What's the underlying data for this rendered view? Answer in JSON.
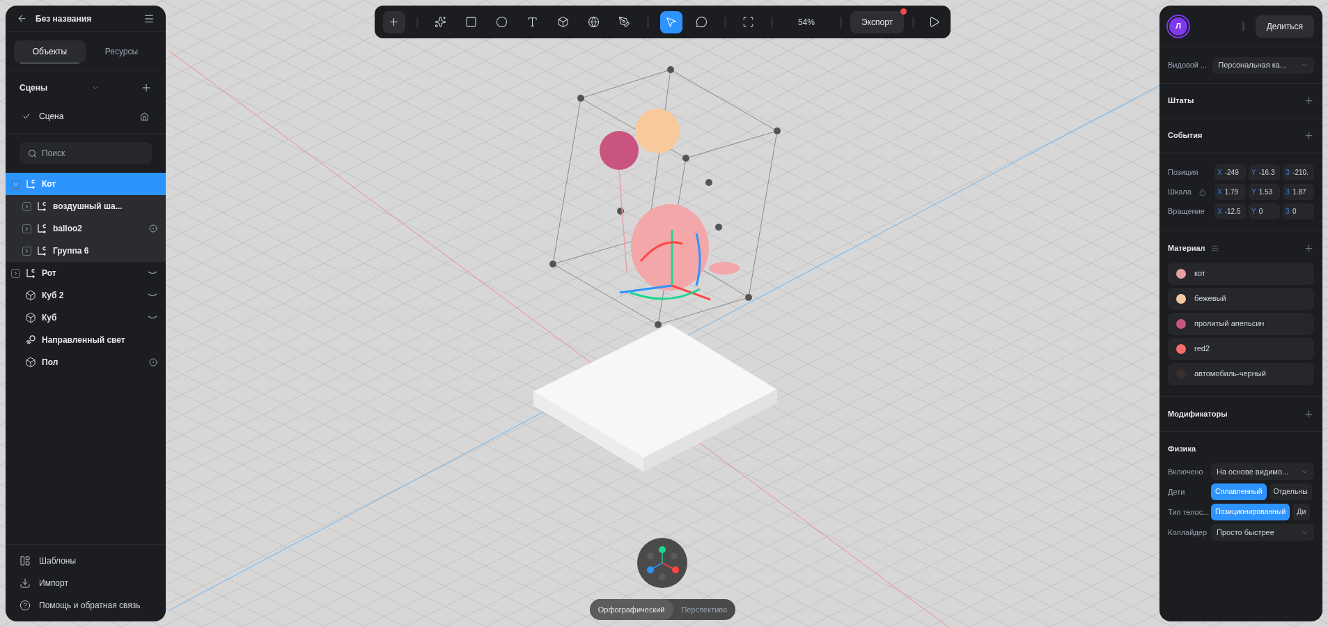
{
  "left_panel": {
    "title": "Без названия",
    "tabs": [
      {
        "label": "Объекты",
        "selected": true
      },
      {
        "label": "Ресурсы",
        "selected": false
      }
    ],
    "scenes_header": "Сцены",
    "scenes": [
      {
        "label": "Сцена",
        "selected": true
      }
    ],
    "search": {
      "placeholder": "Поиск"
    },
    "tree": [
      {
        "label": "Кот",
        "kind": "group",
        "selected": true,
        "expanded": true,
        "children": [
          {
            "label": "воздушный ша...",
            "kind": "group",
            "selected": false,
            "expanded": false
          },
          {
            "label": "balloo2",
            "kind": "group",
            "selected": false,
            "expanded": false,
            "indicator": {
              "kind": "target"
            }
          },
          {
            "label": "Группа 6",
            "kind": "group",
            "selected": false,
            "expanded": false
          }
        ]
      },
      {
        "label": "Рот",
        "kind": "group",
        "selected": false,
        "expanded": false,
        "indicator": {
          "kind": "curve"
        }
      },
      {
        "label": "Куб 2",
        "kind": "cube",
        "selected": false,
        "indicator": {
          "kind": "curve"
        }
      },
      {
        "label": "Куб",
        "kind": "cube",
        "selected": false,
        "indicator": {
          "kind": "curve"
        }
      },
      {
        "label": "Направленный свет",
        "kind": "light",
        "selected": false
      },
      {
        "label": "Пол",
        "kind": "cube",
        "selected": false,
        "indicator": {
          "kind": "target"
        }
      }
    ],
    "footer": [
      {
        "label": "Шаблоны",
        "kind": "templates"
      },
      {
        "label": "Импорт",
        "kind": "import"
      },
      {
        "label": "Помощь и обратная связь",
        "kind": "help"
      }
    ]
  },
  "toolbar": {
    "tools": [
      {
        "kind": "add",
        "selected": false
      },
      {
        "kind": "ai",
        "selected": false
      },
      {
        "kind": "rectangle",
        "selected": false
      },
      {
        "kind": "ellipse",
        "selected": false
      },
      {
        "kind": "text",
        "selected": false
      },
      {
        "kind": "cube",
        "selected": false
      },
      {
        "kind": "sphere",
        "selected": false
      },
      {
        "kind": "pen",
        "selected": false
      },
      {
        "kind": "pointer",
        "selected": true
      },
      {
        "kind": "comment",
        "selected": false
      },
      {
        "kind": "frame",
        "selected": false
      }
    ],
    "zoom": "54%",
    "export": {
      "label": "Экспорт",
      "notification": true
    }
  },
  "viewport": {
    "view_modes": [
      {
        "label": "Орфографический",
        "selected": true
      },
      {
        "label": "Перспектива",
        "selected": false
      }
    ]
  },
  "right_panel": {
    "avatar": "Л",
    "share": "Делиться",
    "view": {
      "label": "Видовой ...",
      "value": "Персональная ка..."
    },
    "sections": [
      "Штаты",
      "События"
    ],
    "transform": [
      {
        "label": "Позиция",
        "locked": false,
        "values": [
          {
            "axis": "X",
            "value": "-249"
          },
          {
            "axis": "Y",
            "value": "-16.3"
          },
          {
            "axis": "З",
            "value": "-210."
          }
        ]
      },
      {
        "label": "Шкала",
        "locked": true,
        "values": [
          {
            "axis": "X",
            "value": "1.79"
          },
          {
            "axis": "Y",
            "value": "1.53"
          },
          {
            "axis": "З",
            "value": "1.87"
          }
        ]
      },
      {
        "label": "Вращение",
        "locked": false,
        "values": [
          {
            "axis": "X",
            "value": "-12.5"
          },
          {
            "axis": "Y",
            "value": "0"
          },
          {
            "axis": "З",
            "value": "0"
          }
        ]
      }
    ],
    "material_title": "Материал",
    "materials": [
      {
        "name": "кот",
        "color": "#e8a0a4"
      },
      {
        "name": "бежевый",
        "color": "#f5c9a0"
      },
      {
        "name": "пролитый апельсин",
        "color": "#c9547f"
      },
      {
        "name": "red2",
        "color": "#f76b6b"
      },
      {
        "name": "автомобиль-черный",
        "color": "#3a2e2c"
      }
    ],
    "modifiers_title": "Модификаторы",
    "physics_title": "Физика",
    "physics": [
      {
        "label": "Включено",
        "kind": "select",
        "value": "На основе видимо..."
      },
      {
        "label": "Дети",
        "kind": "segments",
        "options": [
          {
            "label": "Сплавленный",
            "selected": true
          },
          {
            "label": "Отдельны",
            "selected": false
          }
        ]
      },
      {
        "label": "Тип телос...",
        "kind": "segments",
        "options": [
          {
            "label": "Позиционированный",
            "selected": true
          },
          {
            "label": "Ди",
            "selected": false
          }
        ]
      },
      {
        "label": "Коллайдер",
        "kind": "select",
        "value": "Просто быстрее"
      }
    ]
  }
}
